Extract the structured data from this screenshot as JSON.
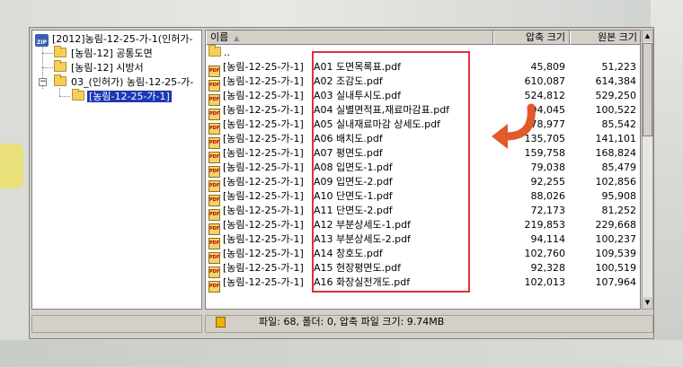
{
  "tree": {
    "root": "[2012]농림-12-25-가-1(인허가-",
    "items": [
      "[농림-12] 공통도면",
      "[농림-12] 시방서",
      "03_(인허가) 농림-12-25-가-",
      "[농림-12-25-가-1]"
    ]
  },
  "columns": {
    "name": "이름",
    "compressed": "압축 크기",
    "original": "원본 크기"
  },
  "parent_dir": "..",
  "rows": [
    {
      "prefix": "[농림-12-25-가-1]",
      "file": "A01 도면목록표.pdf",
      "compressed": "45,809",
      "original": "51,223"
    },
    {
      "prefix": "[농림-12-25-가-1]",
      "file": "A02 조감도.pdf",
      "compressed": "610,087",
      "original": "614,384"
    },
    {
      "prefix": "[농림-12-25-가-1]",
      "file": "A03 실내투시도.pdf",
      "compressed": "524,812",
      "original": "529,250"
    },
    {
      "prefix": "[농림-12-25-가-1]",
      "file": "A04 실별면적표,재료마감표.pdf",
      "compressed": "94,045",
      "original": "100,522"
    },
    {
      "prefix": "[농림-12-25-가-1]",
      "file": "A05 실내재료마감 상세도.pdf",
      "compressed": "78,977",
      "original": "85,542"
    },
    {
      "prefix": "[농림-12-25-가-1]",
      "file": "A06 배치도.pdf",
      "compressed": "135,705",
      "original": "141,101"
    },
    {
      "prefix": "[농림-12-25-가-1]",
      "file": "A07 평면도.pdf",
      "compressed": "159,758",
      "original": "168,824"
    },
    {
      "prefix": "[농림-12-25-가-1]",
      "file": "A08 입면도-1.pdf",
      "compressed": "79,038",
      "original": "85,479"
    },
    {
      "prefix": "[농림-12-25-가-1]",
      "file": "A09 입면도-2.pdf",
      "compressed": "92,255",
      "original": "102,856"
    },
    {
      "prefix": "[농림-12-25-가-1]",
      "file": "A10 단면도-1.pdf",
      "compressed": "88,026",
      "original": "95,908"
    },
    {
      "prefix": "[농림-12-25-가-1]",
      "file": "A11 단면도-2.pdf",
      "compressed": "72,173",
      "original": "81,252"
    },
    {
      "prefix": "[농림-12-25-가-1]",
      "file": "A12 부분상세도-1.pdf",
      "compressed": "219,853",
      "original": "229,668"
    },
    {
      "prefix": "[농림-12-25-가-1]",
      "file": "A13 부분상세도-2.pdf",
      "compressed": "94,114",
      "original": "100,237"
    },
    {
      "prefix": "[농림-12-25-가-1]",
      "file": "A14 창호도.pdf",
      "compressed": "102,760",
      "original": "109,539"
    },
    {
      "prefix": "[농림-12-25-가-1]",
      "file": "A15 현장평면도.pdf",
      "compressed": "92,328",
      "original": "100,519"
    },
    {
      "prefix": "[농림-12-25-가-1]",
      "file": "A16 화장실전개도.pdf",
      "compressed": "102,013",
      "original": "107,964"
    }
  ],
  "status": {
    "summary": "파일: 68, 폴더: 0, 압축 파일 크기: 9.74MB"
  },
  "colors": {
    "selection": "#1d38b5",
    "highlight": "#e0303a",
    "arrow": "#e05a2a"
  }
}
